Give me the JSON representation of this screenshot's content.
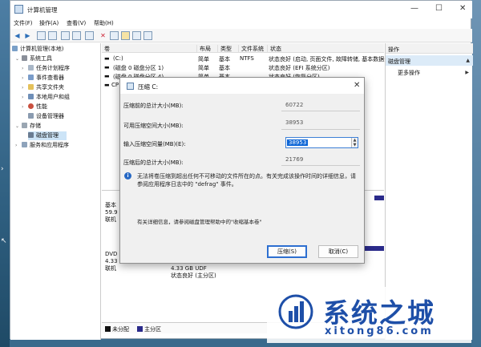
{
  "window": {
    "title": "计算机管理",
    "min": "—",
    "max": "☐",
    "close": "✕"
  },
  "menu": [
    "文件(F)",
    "操作(A)",
    "查看(V)",
    "帮助(H)"
  ],
  "tree": {
    "root": "计算机管理(本地)",
    "system_tools": "系统工具",
    "task_scheduler": "任务计划程序",
    "event_viewer": "事件查看器",
    "shared_folders": "共享文件夹",
    "local_users": "本地用户和组",
    "performance": "性能",
    "device_manager": "设备管理器",
    "storage": "存储",
    "disk_mgmt": "磁盘管理",
    "services": "服务和应用程序"
  },
  "volume_header": {
    "vol": "卷",
    "layout": "布局",
    "type": "类型",
    "fs": "文件系统",
    "status": "状态"
  },
  "volumes": [
    {
      "vol": "(C:)",
      "layout": "简单",
      "type": "基本",
      "fs": "NTFS",
      "status": "状态良好 (启动, 页面文件, 故障转储, 基本数据分"
    },
    {
      "vol": "(磁盘 0 磁盘分区 1)",
      "layout": "简单",
      "type": "基本",
      "fs": "",
      "status": "状态良好 (EFI 系统分区)"
    },
    {
      "vol": "(磁盘 0 磁盘分区 4)",
      "layout": "简单",
      "type": "基本",
      "fs": "",
      "status": "状态良好 (恢复分区)"
    },
    {
      "vol": "CP",
      "layout": "",
      "type": "",
      "fs": "",
      "status": ""
    }
  ],
  "disks": {
    "disk0_l1": "基本",
    "disk0_l2": "59.9",
    "disk0_l3": "联机",
    "dvd_l1": "DVD",
    "dvd_l2": "4.33 GB",
    "dvd_l3": "联机",
    "dvd_part_l1": "4.33 GB UDF",
    "dvd_part_l2": "状态良好 (主分区)"
  },
  "legend": {
    "unalloc": "未分配",
    "primary": "主分区"
  },
  "actions": {
    "header": "操作",
    "section": "磁盘管理",
    "more": "更多操作"
  },
  "dialog": {
    "title": "压缩 C:",
    "total_label": "压缩前的总计大小(MB):",
    "total_value": "60722",
    "avail_label": "可用压缩空间大小(MB):",
    "avail_value": "38953",
    "input_label": "输入压缩空间量(MB)(E):",
    "input_value": "38953",
    "after_label": "压缩后的总计大小(MB):",
    "after_value": "21769",
    "info": "无法将卷压缩到超出任何不可移动的文件所在的点。有关完成该操作时间的详细信息，请参阅应用程序日志中的 \"defrag\" 事件。",
    "help": "有关详细信息，请参阅磁盘管理帮助中的\"收缩基本卷\"",
    "ok": "压缩(S)",
    "cancel": "取消(C)"
  },
  "watermark": {
    "name": "系统之城",
    "url": "xitong86.com"
  },
  "colors": {
    "accent": "#0a64d6",
    "disk_bar": "#2a2a8a",
    "brand": "#1e4fa8"
  }
}
